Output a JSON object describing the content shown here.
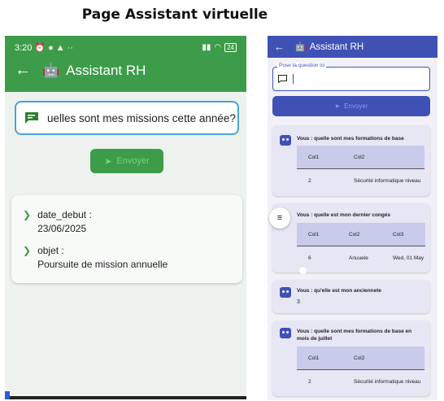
{
  "page_title": "Page Assistant virtuelle",
  "left_phone": {
    "status_time": "3:20",
    "status_battery": "24",
    "app_title": "Assistant RH",
    "input_value": "uelles sont mes missions cette année?",
    "send_label": "Envoyer",
    "result": {
      "field1_label": "date_debut :",
      "field1_value": "23/06/2025",
      "field2_label": "objet :",
      "field2_value": "Poursuite de mission annuelle"
    },
    "colors": {
      "header": "#3d9c49",
      "input_border": "#4aa3d4"
    }
  },
  "right_phone": {
    "app_title": "Assistant RH",
    "input_label": "Pose ta question ici",
    "input_value": "",
    "send_label": "Envoyer",
    "cards": [
      {
        "question": "Vous : quelle sont mes formations de base",
        "headers": [
          "Col1",
          "Col2"
        ],
        "row": [
          "2",
          "Sécurité informatique niveau"
        ]
      },
      {
        "question": "Vous : quelle est mon dernier congés",
        "headers": [
          "Col1",
          "Col2",
          "Col3"
        ],
        "row": [
          "6",
          "Anuuele",
          "Wed, 01 May"
        ]
      },
      {
        "question": "Vous : qu'elle est mon anciennete",
        "answer": "3"
      },
      {
        "question": "Vous : quelle sont mes formations de base en mois de juillet",
        "headers": [
          "Col1",
          "Col2"
        ],
        "row": [
          "2",
          "Sécurité informatique niveau"
        ]
      }
    ],
    "colors": {
      "header": "#3f51b5",
      "card": "#e6e6f5",
      "table_header": "#c9cbea"
    }
  }
}
